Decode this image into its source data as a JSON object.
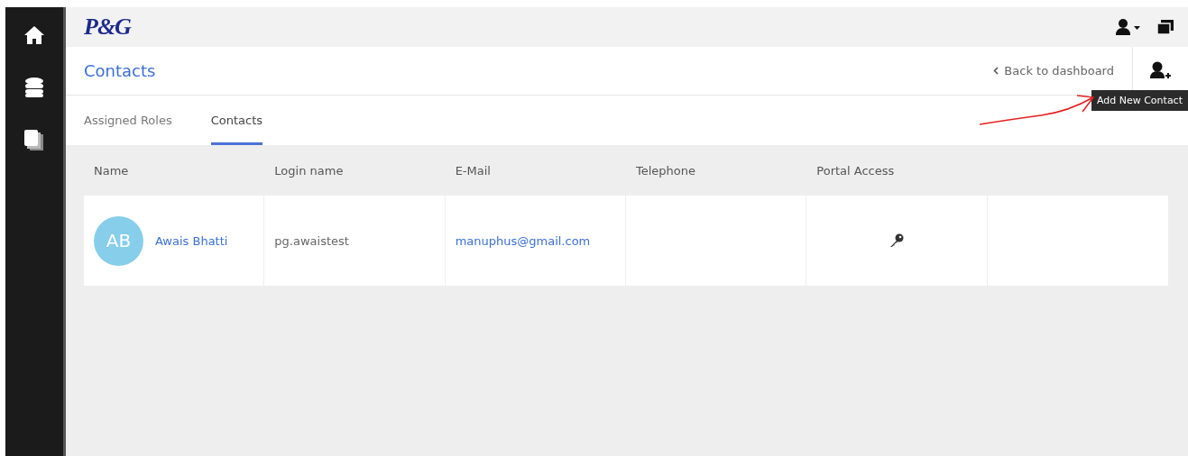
{
  "logo": "P&G",
  "page": {
    "title": "Contacts",
    "back_link": "Back to dashboard",
    "tooltip": "Add New Contact"
  },
  "tabs": [
    {
      "label": "Assigned Roles",
      "selected": false
    },
    {
      "label": "Contacts",
      "selected": true
    }
  ],
  "table": {
    "columns": [
      "Name",
      "Login name",
      "E-Mail",
      "Telephone",
      "Portal Access"
    ],
    "rows": [
      {
        "initials": "AB",
        "name": "Awais Bhatti",
        "login": "pg.awaistest",
        "email": "manuphus@gmail.com",
        "portal_access": true
      }
    ]
  }
}
